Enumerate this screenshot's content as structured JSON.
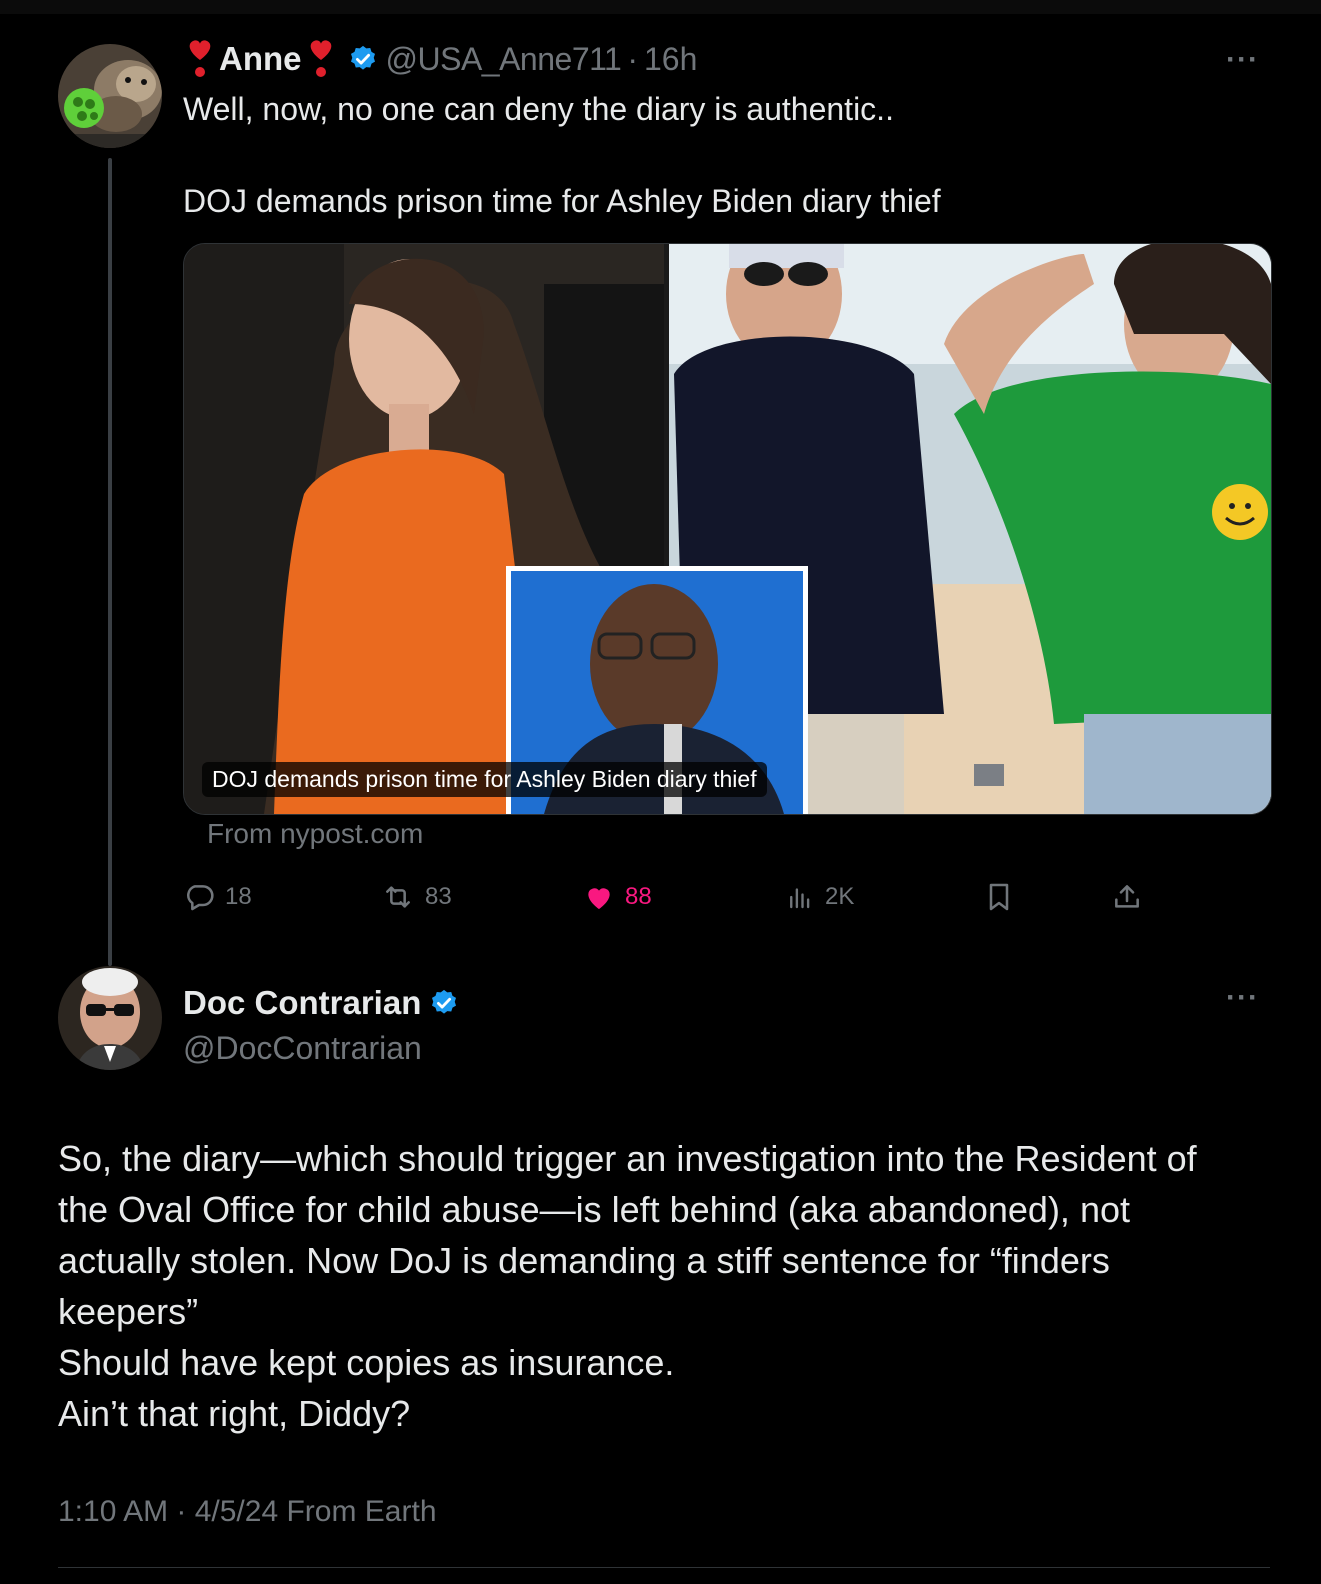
{
  "tweet1": {
    "display_name": "Anne",
    "handle": "@USA_Anne711",
    "separator": "·",
    "time": "16h",
    "more": "···",
    "text_line1": "Well, now, no one can deny the diary is authentic..",
    "text_line2": "DOJ demands prison time for Ashley Biden diary thief",
    "card": {
      "caption": "DOJ demands prison time for Ashley Biden diary thief",
      "source": "From nypost.com"
    },
    "actions": {
      "replies": "18",
      "reposts": "83",
      "likes": "88",
      "views": "2K"
    }
  },
  "tweet2": {
    "display_name": "Doc Contrarian",
    "handle": "@DocContrarian",
    "more": "···",
    "lines": [
      "So, the diary—which should trigger an investigation into the Resident of",
      "the Oval Office for child abuse—is left behind (aka abandoned), not",
      "actually stolen. Now DoJ is demanding a stiff sentence for “finders",
      "keepers”",
      "Should have kept copies as insurance.",
      "Ain’t that right, Diddy?"
    ],
    "meta": "1:10 AM · 4/5/24 From Earth"
  },
  "colors": {
    "background": "#000000",
    "text": "#e7e9ea",
    "muted": "#71767b",
    "verified": "#1d9bf0",
    "like": "#f91880",
    "emoji_red": "#e0202c"
  },
  "icons": [
    "reply-icon",
    "repost-icon",
    "like-icon",
    "views-icon",
    "bookmark-icon",
    "share-icon",
    "verified-icon",
    "heart-exclamation-icon"
  ]
}
